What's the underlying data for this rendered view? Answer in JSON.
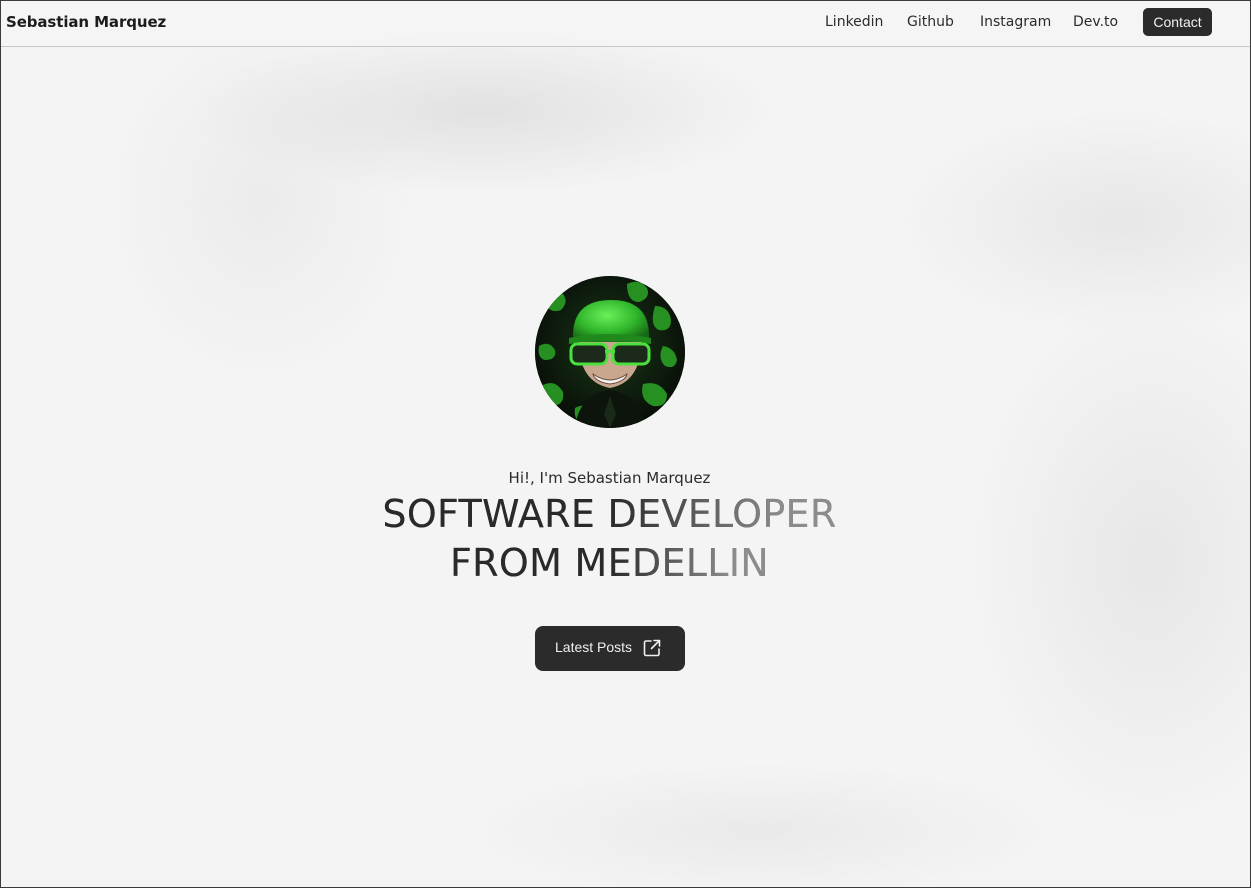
{
  "header": {
    "brand": "Sebastian Marquez",
    "nav": [
      {
        "label": "Linkedin",
        "icon": ""
      },
      {
        "label": "Github",
        "icon": ""
      },
      {
        "label": "Instagram",
        "icon": ""
      },
      {
        "label": "Dev.to",
        "icon": ""
      }
    ],
    "contact_label": "Contact"
  },
  "hero": {
    "greeting": "Hi!, I'm Sebastian Marquez",
    "headline_line1": "SOFTWARE DEVELOPER",
    "headline_line2": "FROM MEDELLIN",
    "cta_label": "Latest Posts",
    "cta_icon": "external-link-icon",
    "avatar_icon": "avatar-image"
  },
  "colors": {
    "background": "#f4f4f4",
    "button_dark": "#2b2b2b",
    "button_text": "#f0f0f0",
    "avatar_green": "#2fb52a"
  }
}
